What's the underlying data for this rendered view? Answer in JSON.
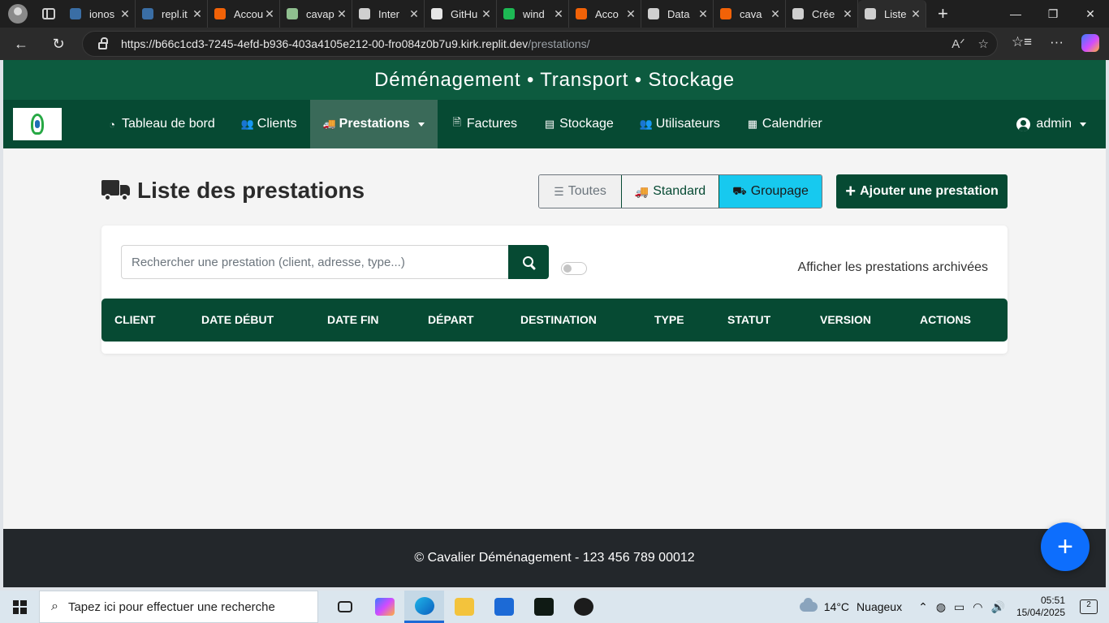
{
  "browser": {
    "tabs": [
      {
        "label": "ionos",
        "icon": "search-icon",
        "color": "#3a6ea5"
      },
      {
        "label": "repl.it",
        "icon": "search-icon",
        "color": "#3a6ea5"
      },
      {
        "label": "Accou",
        "icon": "replit-icon",
        "color": "#f26207"
      },
      {
        "label": "cavap",
        "icon": "app-icon",
        "color": "#8fbf8f"
      },
      {
        "label": "Inter",
        "icon": "globe-icon",
        "color": "#cfcfcf"
      },
      {
        "label": "GitHu",
        "icon": "github-icon",
        "color": "#e6e6e6"
      },
      {
        "label": "wind",
        "icon": "windsurf-icon",
        "color": "#1db954"
      },
      {
        "label": "Acco",
        "icon": "replit-icon",
        "color": "#f26207"
      },
      {
        "label": "Data",
        "icon": "globe-icon",
        "color": "#cfcfcf"
      },
      {
        "label": "cava",
        "icon": "replit-icon",
        "color": "#f26207"
      },
      {
        "label": "Crée",
        "icon": "globe-icon",
        "color": "#cfcfcf"
      },
      {
        "label": "Liste",
        "icon": "globe-icon",
        "color": "#cfcfcf",
        "active": true
      }
    ],
    "url_host": "https://b66c1cd3-7245-4efd-b936-403a4105e212-00-fro084z0b7u9.kirk.replit.dev",
    "url_path": "/prestations/"
  },
  "app": {
    "banner": "Déménagement • Transport • Stockage",
    "nav": {
      "items": [
        {
          "label": "Tableau de bord",
          "icon": "dashboard-icon"
        },
        {
          "label": "Clients",
          "icon": "users-icon"
        },
        {
          "label": "Prestations",
          "icon": "truck-icon",
          "active": true,
          "dropdown": true
        },
        {
          "label": "Factures",
          "icon": "invoice-icon"
        },
        {
          "label": "Stockage",
          "icon": "box-icon"
        },
        {
          "label": "Utilisateurs",
          "icon": "users-cog-icon"
        },
        {
          "label": "Calendrier",
          "icon": "calendar-icon"
        }
      ],
      "user": "admin"
    },
    "page_title": "Liste des prestations",
    "filters": {
      "all": "Toutes",
      "standard": "Standard",
      "groupage": "Groupage"
    },
    "add_button": "Ajouter une prestation",
    "search": {
      "placeholder": "Rechercher une prestation (client, adresse, type...)"
    },
    "archive_toggle_label": "Afficher les prestations archivées",
    "table": {
      "columns": [
        "CLIENT",
        "DATE DÉBUT",
        "DATE FIN",
        "DÉPART",
        "DESTINATION",
        "TYPE",
        "STATUT",
        "VERSION",
        "ACTIONS"
      ]
    },
    "footer": "© Cavalier Déménagement - 123 456 789 00012",
    "fab_label": "+"
  },
  "taskbar": {
    "search_placeholder": "Tapez ici pour effectuer une recherche",
    "weather_temp": "14°C",
    "weather_text": "Nuageux",
    "time": "05:51",
    "date": "15/04/2025",
    "notifications": "2"
  },
  "colors": {
    "primary_green": "#064a33",
    "banner_green": "#0d5b3f",
    "groupage_cyan": "#17c9ef",
    "fab_blue": "#0d6efd",
    "footer_dark": "#23272b"
  }
}
